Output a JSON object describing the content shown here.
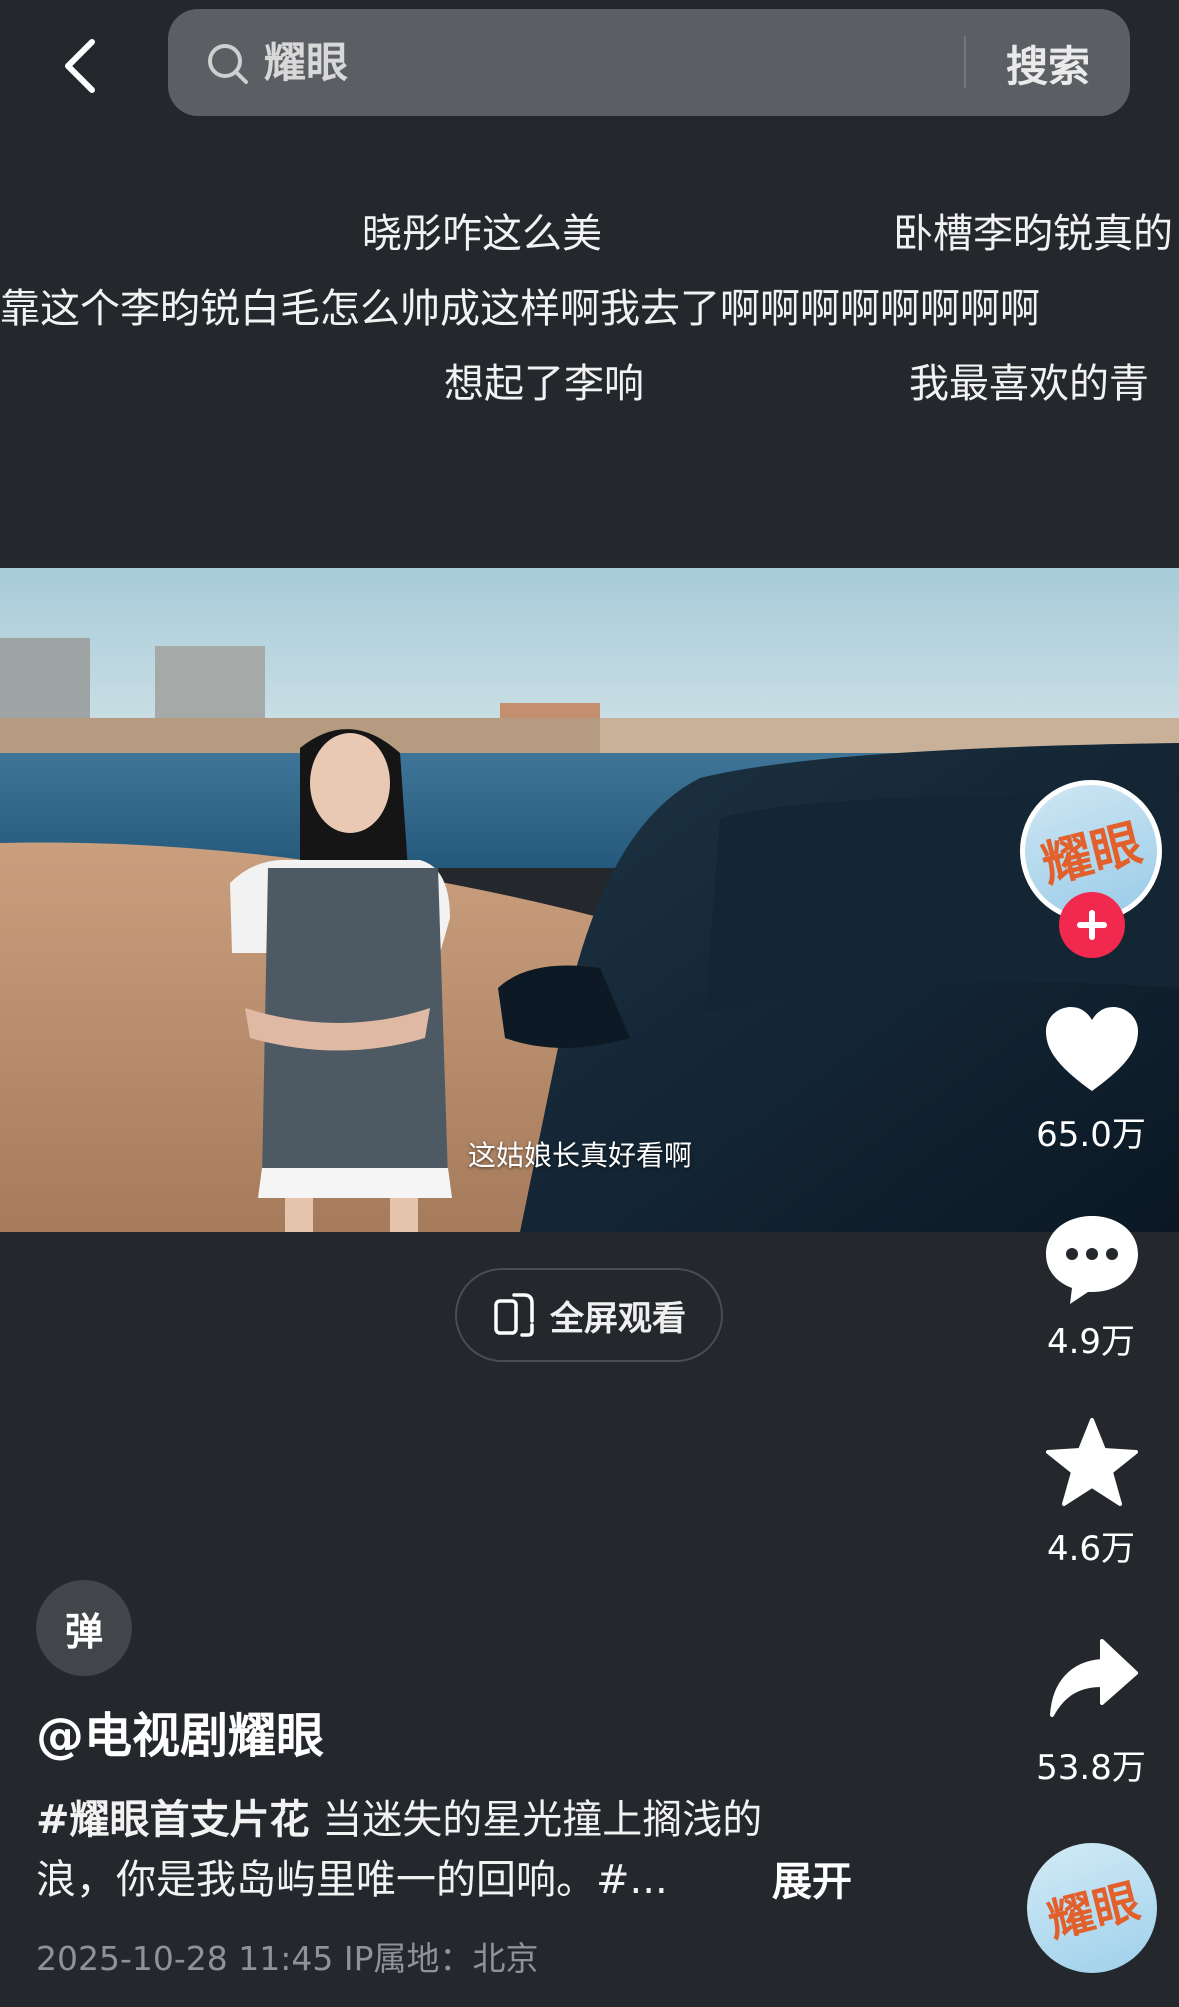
{
  "search": {
    "query": "耀眼",
    "button_label": "搜索"
  },
  "danmaku": [
    {
      "text": "晓彤咋这么美"
    },
    {
      "text": "卧槽李昀锐真的"
    },
    {
      "text": "靠这个李昀锐白毛怎么帅成这样啊我去了啊啊啊啊啊啊啊啊"
    },
    {
      "text": "想起了李响"
    },
    {
      "text": "我最喜欢的青"
    }
  ],
  "video": {
    "subtitle": "这姑娘长真好看啊",
    "fullscreen_label": "全屏观看"
  },
  "rail": {
    "likes": "65.0万",
    "comments": "4.9万",
    "favorites": "4.6万",
    "shares": "53.8万"
  },
  "post": {
    "danmaku_toggle": "弹",
    "author": "@电视剧耀眼",
    "hashtag": "#耀眼首支片花",
    "desc_line1": " 当迷失的星光撞上搁浅的",
    "desc_line2": "浪，你是我岛屿里唯一的回响。#...",
    "expand_label": "展开",
    "meta": "2025-10-28 11:45  IP属地：北京",
    "logo_text": "耀眼"
  },
  "colors": {
    "background": "#24272b",
    "follow": "#f1294e",
    "logo": "#e2602c"
  }
}
